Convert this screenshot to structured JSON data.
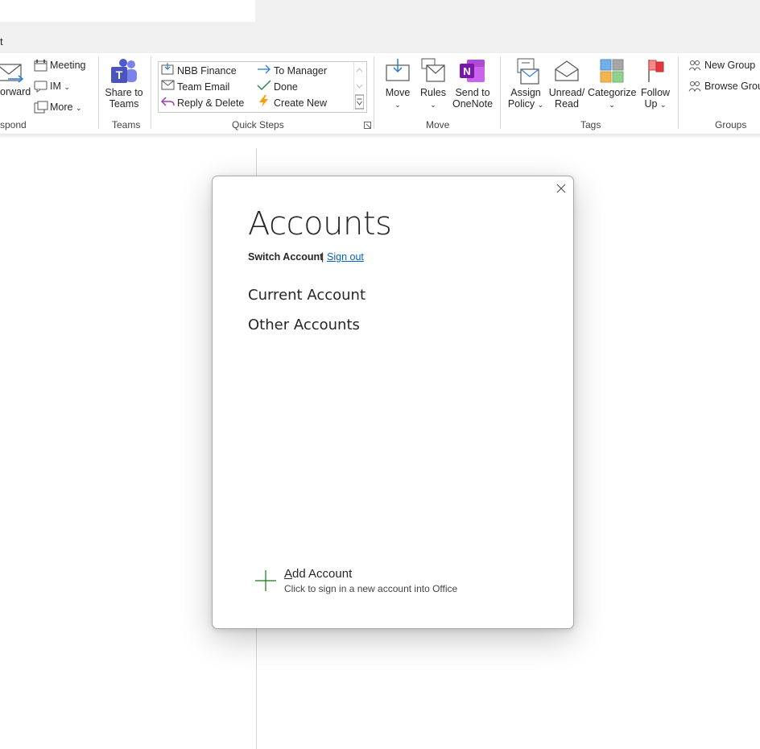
{
  "header": {
    "tab_fragment": "t"
  },
  "ribbon": {
    "respond": {
      "forward_label": "orward",
      "meeting_label": "Meeting",
      "im_label": "IM",
      "more_label": "More",
      "group_label": "spond"
    },
    "teams": {
      "share_line1": "Share to",
      "share_line2": "Teams",
      "group_label": "Teams"
    },
    "quick_steps": {
      "items": [
        "NBB Finance",
        "Team Email",
        "Reply & Delete",
        "To Manager",
        "Done",
        "Create New"
      ],
      "group_label": "Quick Steps"
    },
    "move": {
      "move_label": "Move",
      "rules_label": "Rules",
      "onenote_line1": "Send to",
      "onenote_line2": "OneNote",
      "group_label": "Move"
    },
    "tags": {
      "assign_line1": "Assign",
      "assign_line2": "Policy",
      "unread_line1": "Unread/",
      "unread_line2": "Read",
      "categorize_label": "Categorize",
      "follow_line1": "Follow",
      "follow_line2": "Up",
      "group_label": "Tags"
    },
    "groups": {
      "new_group_label": "New Group",
      "browse_group_label": "Browse Group",
      "group_label": "Groups"
    }
  },
  "dialog": {
    "title": "Accounts",
    "switch_account": "Switch Account",
    "separator": "|",
    "sign_out": "Sign out",
    "current_account_heading": "Current Account",
    "other_accounts_heading": "Other Accounts",
    "add_account": {
      "title_accel": "A",
      "title_rest": "dd Account",
      "subtitle": "Click to sign in a new account into Office"
    }
  },
  "colors": {
    "link": "#0563c1",
    "add_plus": "#107c10",
    "onenote": "#7719aa",
    "teams": "#5059c9",
    "flag": "#e0393e"
  }
}
